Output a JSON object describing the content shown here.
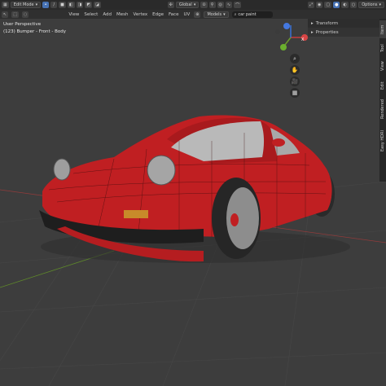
{
  "topbar": {
    "mode": "Edit Mode",
    "menus": [
      "View",
      "Select",
      "Add",
      "Mesh",
      "Vertex",
      "Edge",
      "Face",
      "UV"
    ],
    "orientation": "Global",
    "viewport_filter": "Models",
    "search_value": "car paint",
    "options_label": "Options"
  },
  "viewport": {
    "perspective_label": "User Perspective",
    "object_label": "(123) Bumper - Front - Body"
  },
  "npanel": {
    "items": [
      "Transform",
      "Properties"
    ]
  },
  "side_tabs": [
    "Item",
    "Tool",
    "View",
    "Edit",
    "Rendered",
    "Easy HDRI"
  ],
  "colors": {
    "viewport_bg": "#3d3d3d",
    "accent": "#4772b3",
    "car_body": "#c01f22",
    "axis_x": "#c63c3c",
    "axis_y": "#6c9b2c",
    "axis_z": "#3a72d6"
  },
  "icons": [
    "cursor-tool-icon",
    "select-box-icon",
    "search-icon",
    "move-icon",
    "hand-icon",
    "camera-icon",
    "grid-icon"
  ]
}
